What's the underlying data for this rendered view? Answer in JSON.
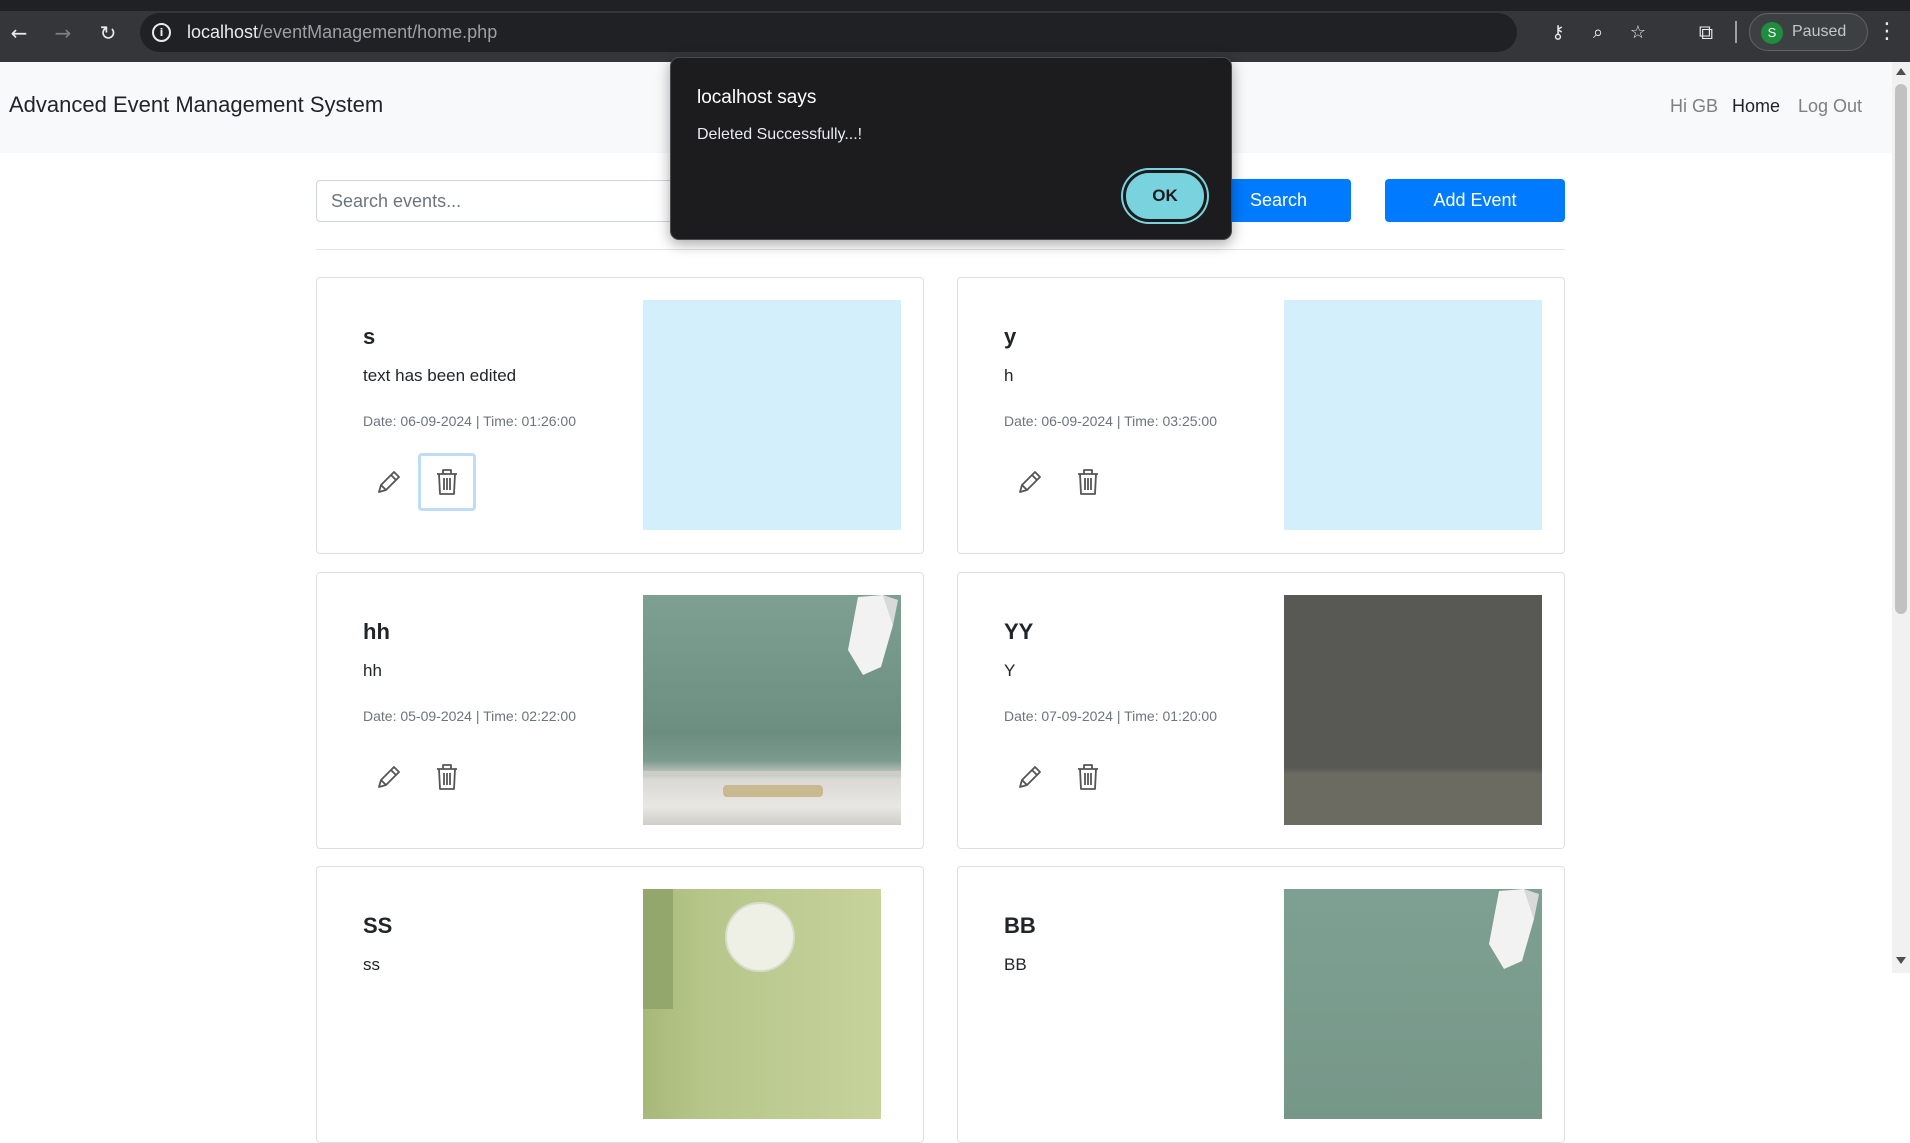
{
  "browser": {
    "url_host": "localhost",
    "url_path": "/eventManagement/home.php",
    "profile_initial": "S",
    "profile_status": "Paused",
    "icons": {
      "back": "arrow-left-icon",
      "forward": "arrow-right-icon",
      "reload": "reload-icon",
      "site_info": "info-icon",
      "password": "key-icon",
      "zoom": "zoom-icon",
      "bookmark": "star-icon",
      "extensions": "puzzle-icon",
      "menu": "kebab-menu-icon"
    }
  },
  "navbar": {
    "brand": "Advanced Event Management System",
    "greeting": "Hi GB",
    "home": "Home",
    "logout": "Log Out"
  },
  "toolbar": {
    "search_placeholder": "Search events...",
    "search_label": "Search",
    "add_label": "Add Event"
  },
  "events": [
    {
      "title": "s",
      "description": "text has been edited",
      "meta": "Date: 06-09-2024 | Time: 01:26:00",
      "image": "light-blue-placeholder"
    },
    {
      "title": "y",
      "description": "h",
      "meta": "Date: 06-09-2024 | Time: 03:25:00",
      "image": "light-blue-placeholder"
    },
    {
      "title": "hh",
      "description": "hh",
      "meta": "Date: 05-09-2024 | Time: 02:22:00",
      "image": "green-wall-living-room"
    },
    {
      "title": "YY",
      "description": "Y",
      "meta": "Date: 07-09-2024 | Time: 01:20:00",
      "image": "dark-grey-wall"
    },
    {
      "title": "SS",
      "description": "ss",
      "meta": "",
      "image": "green-wall-pendant-lamp"
    },
    {
      "title": "BB",
      "description": "BB",
      "meta": "",
      "image": "green-wall-living-room"
    }
  ],
  "dialog": {
    "title": "localhost says",
    "message": "Deleted Successfully...!",
    "ok_label": "OK"
  },
  "colors": {
    "primary": "#007bff",
    "navbar_bg": "#f8f9fa",
    "dialog_bg": "#1c1c1f",
    "ok_button": "#79d3df"
  }
}
